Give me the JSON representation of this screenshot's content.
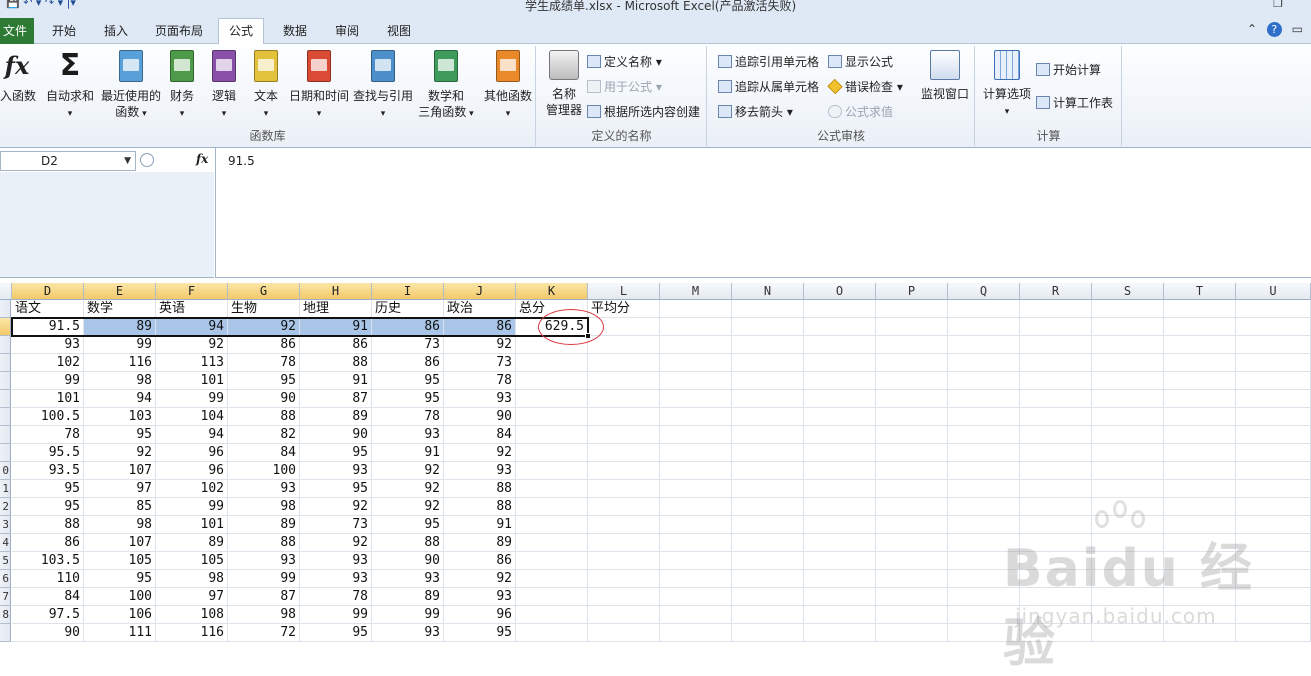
{
  "window": {
    "title": "学生成绩单.xlsx  -  Microsoft Excel(产品激活失败)"
  },
  "tabs": [
    "开始",
    "插入",
    "页面布局",
    "公式",
    "数据",
    "审阅",
    "视图"
  ],
  "file_tab": "文件",
  "active_tab": "公式",
  "ribbon": {
    "function_library": {
      "label": "函数库",
      "insert_function": "入函数",
      "buttons": [
        {
          "line1": "自动求和",
          "line2": "",
          "color": "#1b1b1b",
          "icon": "sigma-icon"
        },
        {
          "line1": "最近使用的",
          "line2": "函数",
          "color": "#5aa0d8",
          "icon": "star-book-icon"
        },
        {
          "line1": "财务",
          "line2": "",
          "color": "#4e9a4a",
          "icon": "finance-book-icon"
        },
        {
          "line1": "逻辑",
          "line2": "",
          "color": "#8a4fa8",
          "icon": "logic-book-icon"
        },
        {
          "line1": "文本",
          "line2": "",
          "color": "#e2c23a",
          "icon": "text-book-icon"
        },
        {
          "line1": "日期和时间",
          "line2": "",
          "color": "#d94b34",
          "icon": "date-book-icon"
        },
        {
          "line1": "查找与引用",
          "line2": "",
          "color": "#4d8fcb",
          "icon": "lookup-book-icon"
        },
        {
          "line1": "数学和",
          "line2": "三角函数",
          "color": "#3e9b5c",
          "icon": "math-book-icon"
        },
        {
          "line1": "其他函数",
          "line2": "",
          "color": "#e9892a",
          "icon": "more-books-icon"
        }
      ]
    },
    "defined_names": {
      "label": "定义的名称",
      "name_manager": {
        "line1": "名称",
        "line2": "管理器"
      },
      "define_name": "定义名称",
      "use_in_formula": "用于公式",
      "create_from_selection": "根据所选内容创建"
    },
    "formula_auditing": {
      "label": "公式审核",
      "trace_precedents": "追踪引用单元格",
      "trace_dependents": "追踪从属单元格",
      "remove_arrows": "移去箭头",
      "show_formulas": "显示公式",
      "error_checking": "错误检查",
      "evaluate_formula": "公式求值",
      "watch_window": "监视窗口"
    },
    "calculation": {
      "label": "计算",
      "calc_options": "计算选项",
      "calc_now": "开始计算",
      "calc_sheet": "计算工作表"
    }
  },
  "formula_bar": {
    "name_box": "D2",
    "fx": "fx",
    "value": "91.5"
  },
  "sheet": {
    "columns": [
      "D",
      "E",
      "F",
      "G",
      "H",
      "I",
      "J",
      "K",
      "L",
      "M",
      "N",
      "O",
      "P",
      "Q",
      "R",
      "S",
      "T",
      "U"
    ],
    "row_numbers": [
      "",
      "",
      "",
      "",
      "",
      "",
      "",
      "",
      "",
      "0",
      "1",
      "2",
      "3",
      "4",
      "5",
      "6",
      "7",
      "8",
      ""
    ],
    "header_row": [
      "语文",
      "数学",
      "英语",
      "生物",
      "地理",
      "历史",
      "政治",
      "总分",
      "平均分"
    ],
    "rows": [
      [
        "91.5",
        "89",
        "94",
        "92",
        "91",
        "86",
        "86",
        "629.5"
      ],
      [
        "93",
        "99",
        "92",
        "86",
        "86",
        "73",
        "92"
      ],
      [
        "102",
        "116",
        "113",
        "78",
        "88",
        "86",
        "73"
      ],
      [
        "99",
        "98",
        "101",
        "95",
        "91",
        "95",
        "78"
      ],
      [
        "101",
        "94",
        "99",
        "90",
        "87",
        "95",
        "93"
      ],
      [
        "100.5",
        "103",
        "104",
        "88",
        "89",
        "78",
        "90"
      ],
      [
        "78",
        "95",
        "94",
        "82",
        "90",
        "93",
        "84"
      ],
      [
        "95.5",
        "92",
        "96",
        "84",
        "95",
        "91",
        "92"
      ],
      [
        "93.5",
        "107",
        "96",
        "100",
        "93",
        "92",
        "93"
      ],
      [
        "95",
        "97",
        "102",
        "93",
        "95",
        "92",
        "88"
      ],
      [
        "95",
        "85",
        "99",
        "98",
        "92",
        "92",
        "88"
      ],
      [
        "88",
        "98",
        "101",
        "89",
        "73",
        "95",
        "91"
      ],
      [
        "86",
        "107",
        "89",
        "88",
        "92",
        "88",
        "89"
      ],
      [
        "103.5",
        "105",
        "105",
        "93",
        "93",
        "90",
        "86"
      ],
      [
        "110",
        "95",
        "98",
        "99",
        "93",
        "93",
        "92"
      ],
      [
        "84",
        "100",
        "97",
        "87",
        "78",
        "89",
        "93"
      ],
      [
        "97.5",
        "106",
        "108",
        "98",
        "99",
        "99",
        "96"
      ],
      [
        "90",
        "111",
        "116",
        "72",
        "95",
        "93",
        "95"
      ]
    ]
  },
  "watermark": {
    "brand": "Bai",
    "brand2": "du",
    "cn": "经验",
    "url": "jingyan.baidu.com"
  }
}
